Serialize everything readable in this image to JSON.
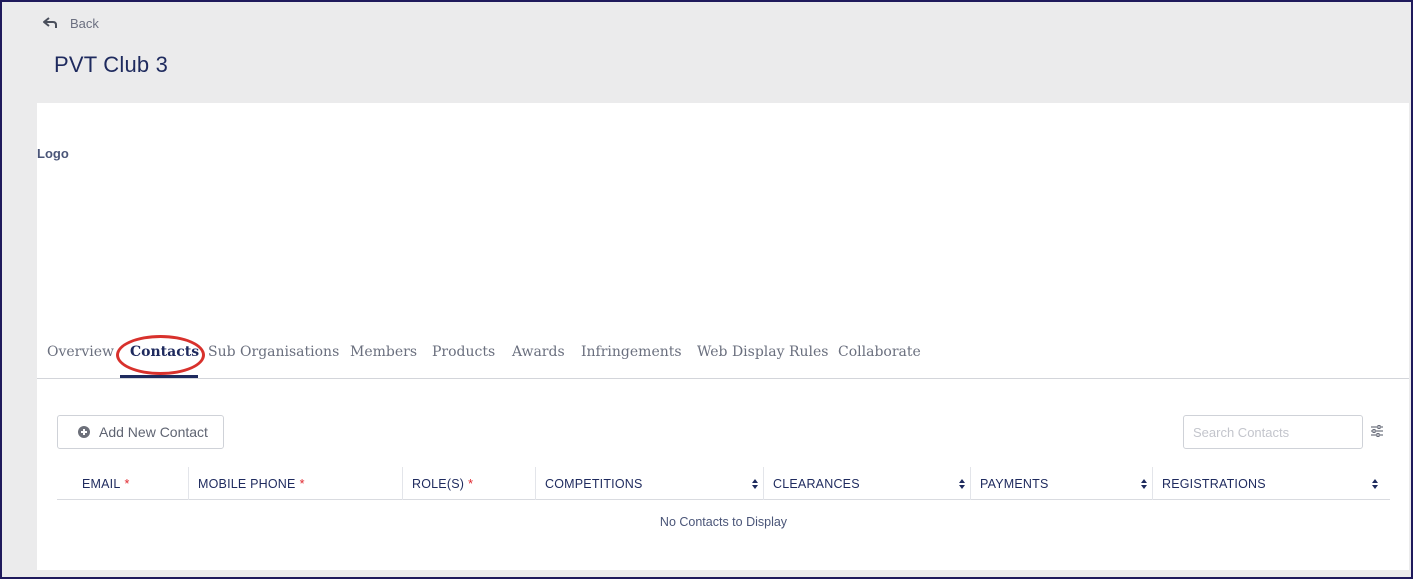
{
  "header": {
    "back_label": "Back",
    "title": "PVT Club 3"
  },
  "card": {
    "logo_label": "Logo"
  },
  "tabs": [
    {
      "label": "Overview",
      "active": false
    },
    {
      "label": "Contacts",
      "active": true
    },
    {
      "label": "Sub Organisations",
      "active": false
    },
    {
      "label": "Members",
      "active": false
    },
    {
      "label": "Products",
      "active": false
    },
    {
      "label": "Awards",
      "active": false
    },
    {
      "label": "Infringements",
      "active": false
    },
    {
      "label": "Web Display Rules",
      "active": false
    },
    {
      "label": "Collaborate",
      "active": false
    }
  ],
  "toolbar": {
    "add_label": "Add New Contact",
    "search_placeholder": "Search Contacts",
    "search_value": ""
  },
  "table": {
    "columns": [
      {
        "label": "EMAIL",
        "required": "*",
        "sortable": false
      },
      {
        "label": "MOBILE PHONE",
        "required": "*",
        "sortable": false
      },
      {
        "label": "ROLE(S)",
        "required": "*",
        "sortable": false
      },
      {
        "label": "COMPETITIONS",
        "required": "",
        "sortable": true
      },
      {
        "label": "CLEARANCES",
        "required": "",
        "sortable": true
      },
      {
        "label": "PAYMENTS",
        "required": "",
        "sortable": true
      },
      {
        "label": "REGISTRATIONS",
        "required": "",
        "sortable": true
      }
    ],
    "empty_message": "No Contacts to Display"
  },
  "colors": {
    "accent": "#1e2a5e",
    "required": "#e0262d",
    "highlight": "#d8312c",
    "frame": "#1f1a5c"
  }
}
